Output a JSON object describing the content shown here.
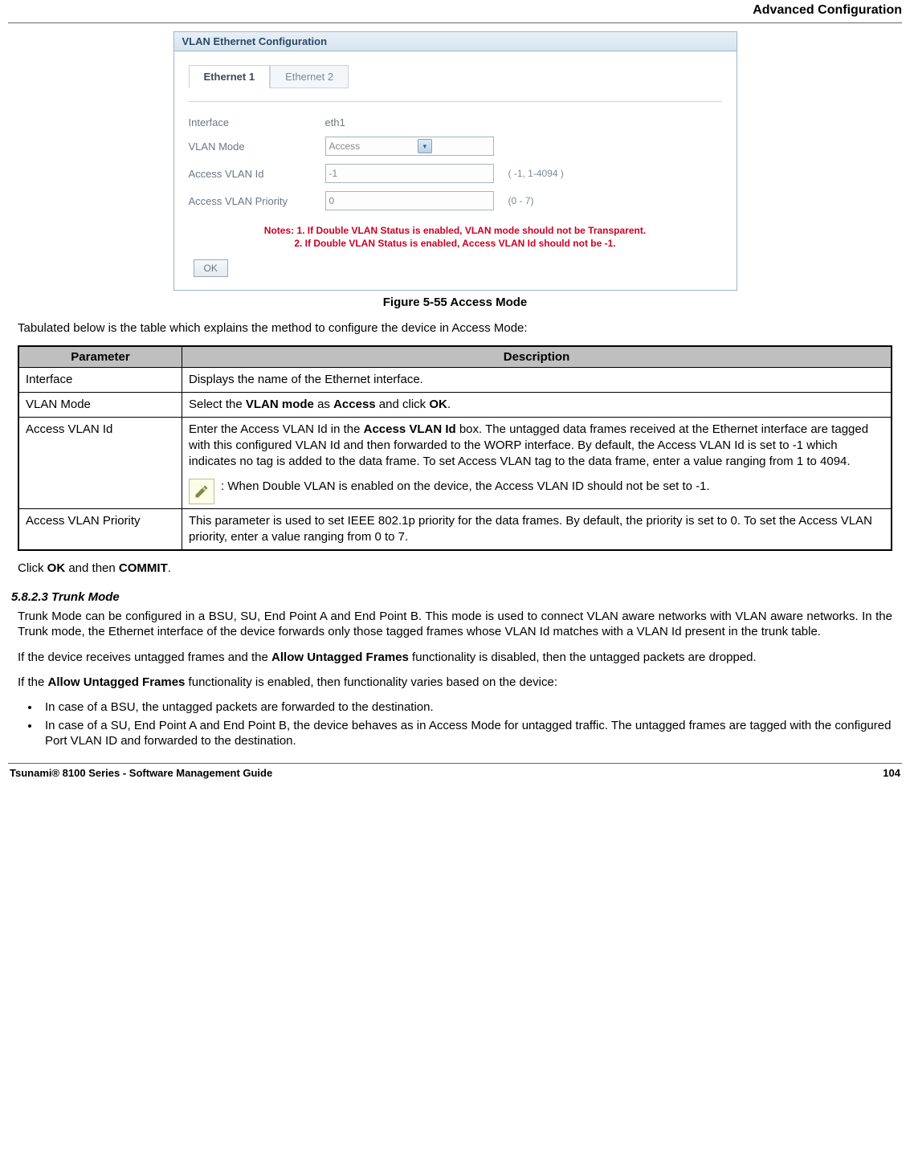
{
  "header": {
    "section": "Advanced Configuration"
  },
  "screenshot": {
    "panel_title": "VLAN Ethernet Configuration",
    "tabs": [
      "Ethernet 1",
      "Ethernet 2"
    ],
    "active_tab": 0,
    "rows": {
      "interface_label": "Interface",
      "interface_value": "eth1",
      "vlan_mode_label": "VLAN Mode",
      "vlan_mode_value": "Access",
      "access_id_label": "Access VLAN Id",
      "access_id_value": "-1",
      "access_id_range": "( -1, 1-4094 )",
      "access_pri_label": "Access VLAN Priority",
      "access_pri_value": "0",
      "access_pri_range": "(0 - 7)"
    },
    "notes_line1": "Notes: 1. If Double VLAN Status is enabled, VLAN mode should not be Transparent.",
    "notes_line2": "2. If Double VLAN Status is enabled, Access VLAN Id should not be -1.",
    "ok_button": "OK"
  },
  "figure_caption": "Figure 5-55 Access Mode",
  "intro_text": "Tabulated below is the table which explains the method to configure the device in  Access Mode:",
  "table": {
    "header_param": "Parameter",
    "header_desc": "Description",
    "r1_param": "Interface",
    "r1_desc": "Displays the name of the Ethernet interface.",
    "r2_param": "VLAN Mode",
    "r2_desc_pre": "Select the ",
    "r2_desc_b1": "VLAN mode",
    "r2_desc_mid": " as ",
    "r2_desc_b2": "Access",
    "r2_desc_post": " and click ",
    "r2_desc_b3": "OK",
    "r2_desc_end": ".",
    "r3_param": "Access VLAN Id",
    "r3_desc_1a": "Enter the Access VLAN Id in the ",
    "r3_desc_1b": "Access VLAN Id",
    "r3_desc_1c": " box. The untagged data frames received at the Ethernet interface are tagged with this configured VLAN Id and then forwarded to the WORP interface. By default, the Access VLAN Id is set to -1 which indicates no tag is added to the data frame. To set Access VLAN tag to the data frame, enter a value ranging from 1 to 4094.",
    "r3_note": ": When Double VLAN is enabled on the device, the Access VLAN ID should not be set to -1.",
    "r4_param": "Access VLAN Priority",
    "r4_desc": "This parameter is used to set IEEE 802.1p priority for the data frames. By default, the priority is set to 0. To set the Access VLAN priority, enter a value ranging from 0 to 7."
  },
  "click_line_pre": "Click ",
  "click_line_b1": "OK",
  "click_line_mid": " and then ",
  "click_line_b2": "COMMIT",
  "click_line_end": ".",
  "section_heading": "5.8.2.3 Trunk Mode",
  "trunk_p1": "Trunk Mode can be configured in a BSU, SU, End Point A and End Point B. This mode is used to connect VLAN aware networks with VLAN aware networks. In the Trunk mode, the Ethernet interface of the device forwards only those tagged frames whose VLAN Id matches with a VLAN Id present in the trunk table.",
  "trunk_p2_pre": "If the device receives untagged frames and the ",
  "trunk_p2_b": "Allow Untagged Frames",
  "trunk_p2_post": " functionality is disabled, then the untagged packets are dropped.",
  "trunk_p3_pre": "If the ",
  "trunk_p3_b": "Allow Untagged Frames",
  "trunk_p3_post": " functionality is enabled, then functionality varies based on the device:",
  "bullets": [
    "In case of a BSU, the untagged packets are forwarded to the destination.",
    "In case of a SU, End Point A and End Point B, the device behaves as in Access Mode for untagged traffic. The untagged frames are tagged with the configured Port VLAN ID and forwarded to the destination."
  ],
  "footer": {
    "left": "Tsunami® 8100 Series - Software Management Guide",
    "right": "104"
  }
}
